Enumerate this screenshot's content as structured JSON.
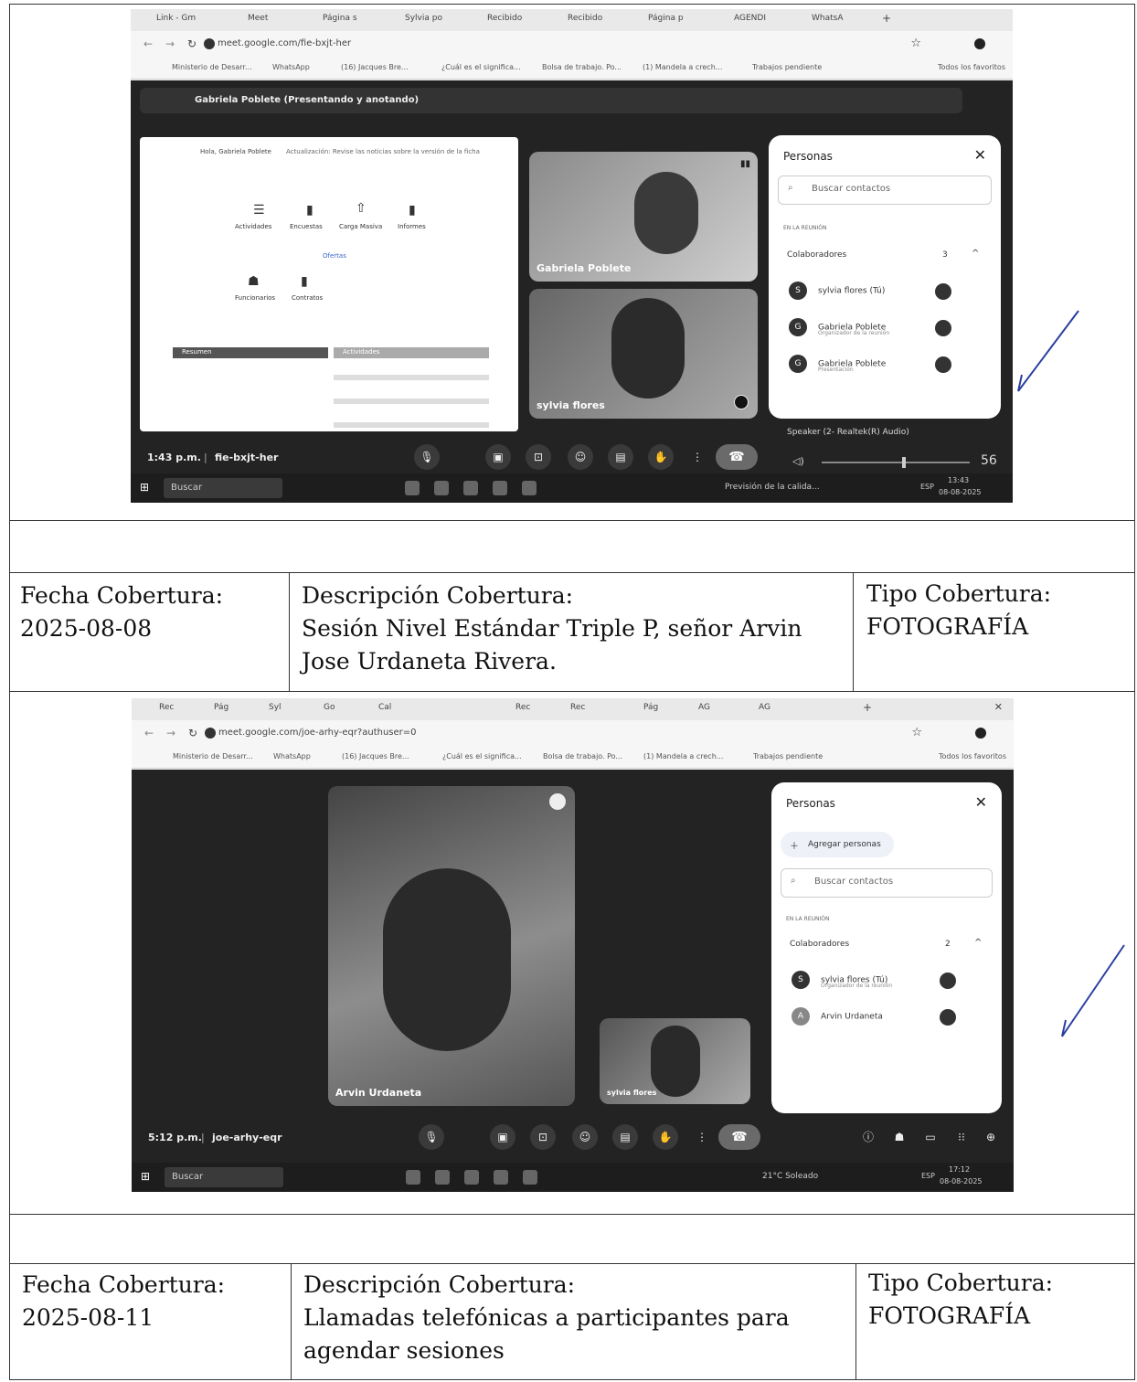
{
  "screenshot1": {
    "tabs": [
      "Link - Gm",
      "Meet",
      "Página s",
      "Sylvia po",
      "Recibido",
      "Recibido",
      "Página p",
      "AGENDI",
      "WhatsA"
    ],
    "url": "meet.google.com/fie-bxjt-her",
    "bookmarks": [
      "Ministerio de Desarr...",
      "WhatsApp",
      "(16) Jacques Bre...",
      "¿Cuál es el significa...",
      "Bolsa de trabajo. Po...",
      "(1) Mandela a crech...",
      "Trabajos pendiente"
    ],
    "bookmarks_all": "Todos los favoritos",
    "presenter_banner": "Gabriela Poblete (Presentando y anotando)",
    "shared_screen": {
      "header_name": "Hola, Gabriela Poblete",
      "header_notice": "Actualización: Revise las noticias sobre la versión de la ficha",
      "icons": [
        "Actividades",
        "Encuestas",
        "Carga Masiva",
        "Informes"
      ],
      "link": "Ofertas",
      "icons2": [
        "Funcionarios",
        "Contratos"
      ],
      "left_box": "Resumen",
      "right_box": "Actividades"
    },
    "tiles": [
      "Gabriela Poblete",
      "sylvia flores"
    ],
    "people_panel": {
      "title": "Personas",
      "search_placeholder": "Buscar contactos",
      "section": "EN LA REUNIÓN",
      "group": "Colaboradores",
      "count": "3",
      "people": [
        {
          "initial": "S",
          "name": "sylvia flores (Tú)",
          "sub": ""
        },
        {
          "initial": "G",
          "name": "Gabriela Poblete",
          "sub": "Organizador de la reunión"
        },
        {
          "initial": "G",
          "name": "Gabriela Poblete",
          "sub": "Presentación"
        }
      ],
      "speaker": "Speaker (2- Realtek(R) Audio)",
      "volume": "56"
    },
    "time": "1:43 p.m.",
    "code": "fie-bxjt-her",
    "taskbar_search": "Buscar",
    "taskbar_weather": "Previsión de la calida...",
    "taskbar_lang": "ESP",
    "taskbar_clock": "13:43",
    "taskbar_date": "08-08-2025"
  },
  "row1": {
    "fecha_label": "Fecha Cobertura:",
    "fecha_value": "2025-08-08",
    "desc_label": "Descripción Cobertura:",
    "desc_value": "Sesión Nivel Estándar Triple P, señor Arvin Jose Urdaneta Rivera.",
    "tipo_label": "Tipo Cobertura:",
    "tipo_value": "FOTOGRAFÍA"
  },
  "screenshot2": {
    "tabs": [
      "Rec",
      "Pág",
      "Syl",
      "Go",
      "Cal",
      "Rec",
      "Rec",
      "Pág",
      "AG",
      "AG"
    ],
    "url": "meet.google.com/joe-arhy-eqr?authuser=0",
    "bookmarks": [
      "Ministerio de Desarr...",
      "WhatsApp",
      "(16) Jacques Bre...",
      "¿Cuál es el significa...",
      "Bolsa de trabajo. Po...",
      "(1) Mandela a crech...",
      "Trabajos pendiente"
    ],
    "bookmarks_all": "Todos los favoritos",
    "tiles": [
      "Arvin Urdaneta",
      "sylvia flores"
    ],
    "people_panel": {
      "title": "Personas",
      "add_people": "Agregar personas",
      "search_placeholder": "Buscar contactos",
      "section": "EN LA REUNIÓN",
      "group": "Colaboradores",
      "count": "2",
      "people": [
        {
          "initial": "S",
          "name": "sylvia flores (Tú)",
          "sub": "Organizador de la reunión"
        },
        {
          "initial": "A",
          "name": "Arvin Urdaneta",
          "sub": ""
        }
      ]
    },
    "time": "5:12 p.m.",
    "code": "joe-arhy-eqr",
    "taskbar_search": "Buscar",
    "taskbar_weather": "21°C Soleado",
    "taskbar_lang": "ESP",
    "taskbar_clock": "17:12",
    "taskbar_date": "08-08-2025"
  },
  "row2": {
    "fecha_label": "Fecha Cobertura:",
    "fecha_value": "2025-08-11",
    "desc_label": "Descripción Cobertura:",
    "desc_value": "Llamadas telefónicas a participantes para agendar sesiones",
    "tipo_label": "Tipo Cobertura:",
    "tipo_value": "FOTOGRAFÍA"
  }
}
